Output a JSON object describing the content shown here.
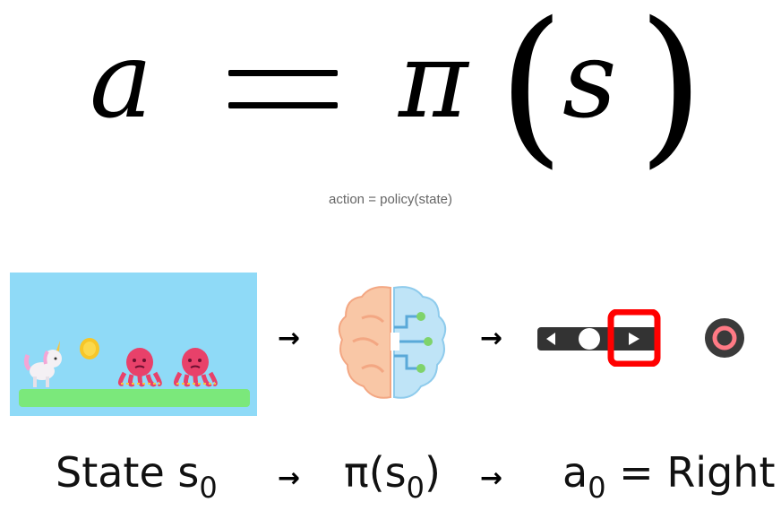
{
  "formula": {
    "action_symbol": "a",
    "equals": "=",
    "policy_symbol": "π",
    "open_paren": "(",
    "state_symbol": "s",
    "close_paren": ")"
  },
  "caption": "action = policy(state)",
  "flow": {
    "arrow": "→",
    "state_label": "State s",
    "state_sub": "0",
    "policy_label_prefix": "π(s",
    "policy_sub": "0",
    "policy_label_suffix": ")",
    "action_label": "a",
    "action_sub": "0",
    "action_value": " = Right"
  },
  "colors": {
    "sky": "#8fdaf7",
    "ground": "#7be87b",
    "highlight": "#ff0000",
    "controller": "#333333",
    "octopus": "#e8416a"
  },
  "icons": [
    "unicorn-icon",
    "coin-icon",
    "octopus-icon",
    "brain-icon",
    "controller-icon",
    "record-button-icon"
  ]
}
